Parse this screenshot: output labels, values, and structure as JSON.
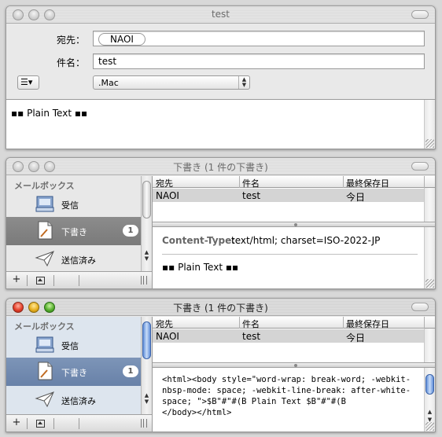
{
  "compose": {
    "title": "test",
    "to_label": "宛先：",
    "to_token": "NAOI",
    "subject_label": "件名：",
    "subject_value": "test",
    "account": ".Mac",
    "body_text": "▪▪ Plain Text ▪▪"
  },
  "viewer1": {
    "title": "下書き (1 件の下書き)",
    "mailbox_header": "メールボックス",
    "items": [
      "受信",
      "下書き",
      "送信済み"
    ],
    "badge": "1",
    "columns": [
      "宛先",
      "件名",
      "最終保存日"
    ],
    "row": [
      "NAOI",
      "test",
      "今日"
    ],
    "ct_label": "Content-Type:",
    "ct_value": "text/html; charset=ISO-2022-JP",
    "preview_text": "▪▪ Plain Text ▪▪",
    "add_label": "+"
  },
  "viewer2": {
    "title": "下書き (1 件の下書き)",
    "mailbox_header": "メールボックス",
    "items": [
      "受信",
      "下書き",
      "送信済み"
    ],
    "badge": "1",
    "columns": [
      "宛先",
      "件名",
      "最終保存日"
    ],
    "row": [
      "NAOI",
      "test",
      "今日"
    ],
    "source": "<html><body style=\"word-wrap: break-word; -webkit-nbsp-mode: space; -webkit-line-break: after-white-space; \">$B\"#\"#(B Plain Text $B\"#\"#(B\n</body></html>",
    "add_label": "+"
  },
  "colors": {
    "selection_gray": "#7a7a7a",
    "selection_blue": "#6881a8",
    "row_gray": "#d4d4d4"
  }
}
